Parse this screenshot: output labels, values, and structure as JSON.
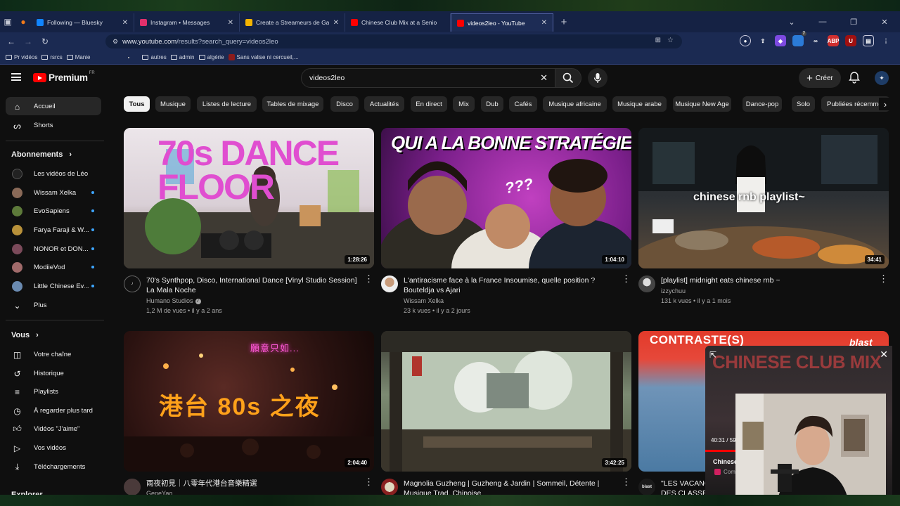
{
  "browser": {
    "tabs": [
      {
        "label": "Following — Bluesky",
        "color": "#1185fe"
      },
      {
        "label": "Instagram • Messages",
        "color": "#e1306c"
      },
      {
        "label": "Create a Streameurs de Gauche",
        "color": "#f5b400"
      },
      {
        "label": "Chinese Club Mix at a Senio",
        "color": "#ff0000"
      },
      {
        "label": "videos2leo - YouTube",
        "color": "#ff0000"
      }
    ],
    "url_host": "www.youtube.com",
    "url_path": "/results?search_query=videos2leo",
    "bookmarks": [
      "Pr vidéos",
      "rsrcs",
      "Manie",
      "autres",
      "admin",
      "algérie",
      "Sans valise ni cercueil,..."
    ],
    "extension_badge": "7"
  },
  "yt": {
    "logo_word": "Premium",
    "region": "FR",
    "search_value": "videos2leo",
    "create_label": "Créer",
    "sidebar": {
      "home": "Accueil",
      "shorts": "Shorts",
      "subscriptions_header": "Abonnements",
      "channels": [
        "Les vidéos de Léo",
        "Wissam Xelka",
        "EvoSapiens",
        "Farya Faraji & W...",
        "NONOR et DON...",
        "ModiieVod",
        "Little Chinese Ev..."
      ],
      "more": "Plus",
      "you_header": "Vous",
      "you_items": [
        "Votre chaîne",
        "Historique",
        "Playlists",
        "À regarder plus tard",
        "Vidéos \"J'aime\"",
        "Vos vidéos",
        "Téléchargements"
      ],
      "explore_header": "Explorer"
    },
    "chips": [
      "Tous",
      "Musique",
      "Listes de lecture",
      "Tables de mixage",
      "Disco",
      "Actualités",
      "En direct",
      "Mix",
      "Dub",
      "Cafés",
      "Musique africaine",
      "Musique arabe",
      "Musique New Age",
      "Dance-pop",
      "Solo",
      "Publiées récemment"
    ],
    "videos": [
      {
        "thumb_text": "70s DANCE FLOOR",
        "duration": "1:28:26",
        "title": "70's Synthpop, Disco, International Dance [Vinyl Studio Session] La Mala Noche",
        "channel": "Humano Studios",
        "views": "1,2 M de vues",
        "age": "il y a 2 ans"
      },
      {
        "thumb_text": "QUI A LA BONNE STRATÉGIE",
        "thumb_text2": "???",
        "duration": "1:04:10",
        "title": "L'antiracisme face à la France Insoumise, quelle position ? Bouteldja vs Ajari",
        "channel": "Wissam Xelka",
        "views": "23 k vues",
        "age": "il y a 2 jours"
      },
      {
        "thumb_text": "chinese rnb playlist~",
        "duration": "34:41",
        "title": "[playlist] midnight eats chinese rnb ~",
        "channel": "izzychuu",
        "views": "131 k vues",
        "age": "il y a 1 mois"
      },
      {
        "thumb_text": "港台 80s 之夜",
        "thumb_text2": "願意只如...",
        "duration": "2:04:40",
        "title": "雨夜初見｜八零年代港台音樂精選",
        "channel": "GeneYao"
      },
      {
        "duration": "3:42:25",
        "title": "Magnolia Guzheng | Guzheng & Jardin | Sommeil, Détente | Musique Trad. Chinoise"
      },
      {
        "thumb_text": "CONTRASTE(S)",
        "thumb_text2": "blast",
        "title": "\"LES VACANC... DES CLASSES",
        "channel_badge": "blast"
      }
    ],
    "mini_player": {
      "overlay_text": "CHINESE CLUB MIX",
      "time": "40:31 / 59",
      "title": "Chinese",
      "sub": "Com"
    }
  }
}
